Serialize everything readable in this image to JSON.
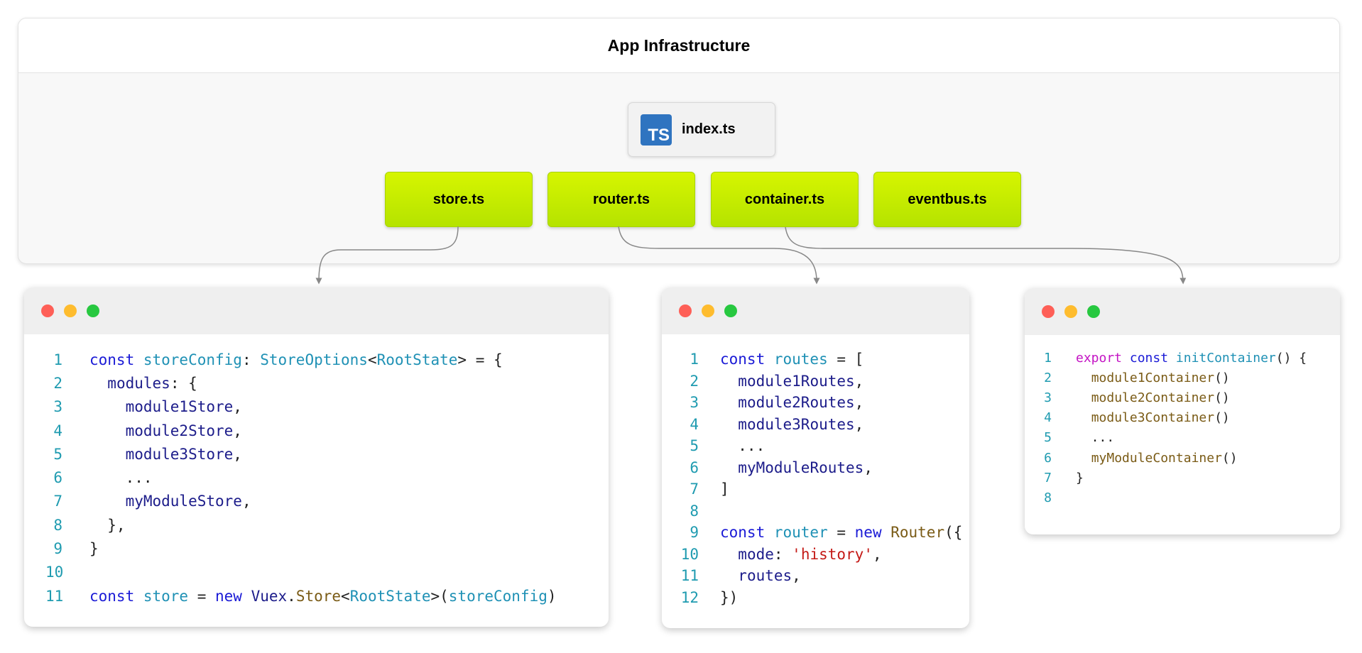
{
  "infrastructure": {
    "title": "App Infrastructure",
    "entry_file": "index.ts",
    "entry_icon": "typescript-icon",
    "entry_icon_text": "TS",
    "modules": [
      "store.ts",
      "router.ts",
      "container.ts",
      "eventbus.ts"
    ]
  },
  "colors": {
    "module_fill": "#c8ee00",
    "ts_blue": "#2f74c0",
    "arrow": "#888888",
    "annotation_arrow": "#f06b6b"
  },
  "code_windows": [
    {
      "lines": [
        [
          [
            "kw",
            "const "
          ],
          [
            "var",
            "storeConfig"
          ],
          [
            "plain",
            ": "
          ],
          [
            "type",
            "StoreOptions"
          ],
          [
            "plain",
            "<"
          ],
          [
            "type",
            "RootState"
          ],
          [
            "plain",
            "> = {"
          ]
        ],
        [
          [
            "plain",
            "  "
          ],
          [
            "ident",
            "modules"
          ],
          [
            "plain",
            ": {"
          ]
        ],
        [
          [
            "plain",
            "    "
          ],
          [
            "ident",
            "module1Store"
          ],
          [
            "plain",
            ","
          ]
        ],
        [
          [
            "plain",
            "    "
          ],
          [
            "ident",
            "module2Store"
          ],
          [
            "plain",
            ","
          ]
        ],
        [
          [
            "plain",
            "    "
          ],
          [
            "ident",
            "module3Store"
          ],
          [
            "plain",
            ","
          ]
        ],
        [
          [
            "plain",
            "    ..."
          ]
        ],
        [
          [
            "plain",
            "    "
          ],
          [
            "ident",
            "myModuleStore"
          ],
          [
            "plain",
            ","
          ]
        ],
        [
          [
            "plain",
            "  },"
          ]
        ],
        [
          [
            "plain",
            "}"
          ]
        ],
        [],
        [
          [
            "kw",
            "const "
          ],
          [
            "var",
            "store"
          ],
          [
            "plain",
            " = "
          ],
          [
            "kw",
            "new "
          ],
          [
            "ident",
            "Vuex"
          ],
          [
            "plain",
            "."
          ],
          [
            "func",
            "Store"
          ],
          [
            "plain",
            "<"
          ],
          [
            "type",
            "RootState"
          ],
          [
            "plain",
            ">("
          ],
          [
            "var",
            "storeConfig"
          ],
          [
            "plain",
            ")"
          ]
        ]
      ]
    },
    {
      "lines": [
        [
          [
            "kw",
            "const "
          ],
          [
            "var",
            "routes"
          ],
          [
            "plain",
            " = ["
          ]
        ],
        [
          [
            "plain",
            "  "
          ],
          [
            "ident",
            "module1Routes"
          ],
          [
            "plain",
            ","
          ]
        ],
        [
          [
            "plain",
            "  "
          ],
          [
            "ident",
            "module2Routes"
          ],
          [
            "plain",
            ","
          ]
        ],
        [
          [
            "plain",
            "  "
          ],
          [
            "ident",
            "module3Routes"
          ],
          [
            "plain",
            ","
          ]
        ],
        [
          [
            "plain",
            "  ..."
          ]
        ],
        [
          [
            "plain",
            "  "
          ],
          [
            "ident",
            "myModuleRoutes"
          ],
          [
            "plain",
            ","
          ]
        ],
        [
          [
            "plain",
            "]"
          ]
        ],
        [],
        [
          [
            "kw",
            "const "
          ],
          [
            "var",
            "router"
          ],
          [
            "plain",
            " = "
          ],
          [
            "kw",
            "new "
          ],
          [
            "func",
            "Router"
          ],
          [
            "plain",
            "({"
          ]
        ],
        [
          [
            "plain",
            "  "
          ],
          [
            "ident",
            "mode"
          ],
          [
            "plain",
            ": "
          ],
          [
            "str",
            "'history'"
          ],
          [
            "plain",
            ","
          ]
        ],
        [
          [
            "plain",
            "  "
          ],
          [
            "ident",
            "routes"
          ],
          [
            "plain",
            ","
          ]
        ],
        [
          [
            "plain",
            "})"
          ]
        ]
      ]
    },
    {
      "lines": [
        [
          [
            "kw2",
            "export "
          ],
          [
            "kw",
            "const "
          ],
          [
            "var",
            "initContainer"
          ],
          [
            "plain",
            "() {"
          ]
        ],
        [
          [
            "plain",
            "  "
          ],
          [
            "func",
            "module1Container"
          ],
          [
            "plain",
            "()"
          ]
        ],
        [
          [
            "plain",
            "  "
          ],
          [
            "func",
            "module2Container"
          ],
          [
            "plain",
            "()"
          ]
        ],
        [
          [
            "plain",
            "  "
          ],
          [
            "func",
            "module3Container"
          ],
          [
            "plain",
            "()"
          ]
        ],
        [
          [
            "plain",
            "  ..."
          ]
        ],
        [
          [
            "plain",
            "  "
          ],
          [
            "func",
            "myModuleContainer"
          ],
          [
            "plain",
            "()"
          ]
        ],
        [
          [
            "plain",
            "}"
          ]
        ],
        []
      ]
    }
  ]
}
